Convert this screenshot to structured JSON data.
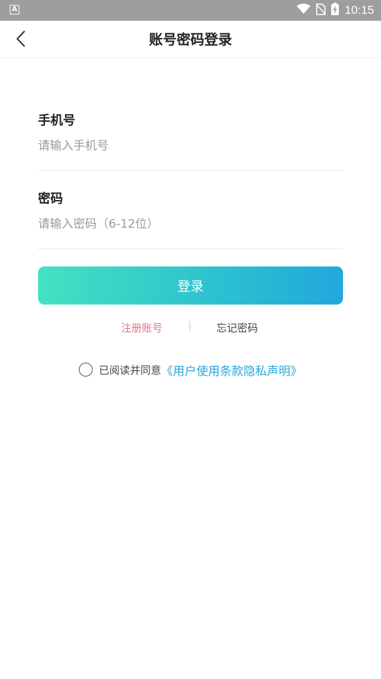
{
  "status_bar": {
    "app_icon_letter": "A",
    "time": "10:15"
  },
  "nav": {
    "title": "账号密码登录"
  },
  "phone": {
    "label": "手机号",
    "placeholder": "请输入手机号",
    "value": ""
  },
  "password": {
    "label": "密码",
    "placeholder": "请输入密码（6-12位）",
    "value": ""
  },
  "login": {
    "label": "登录"
  },
  "links": {
    "register": "注册账号",
    "separator": "|",
    "forgot": "忘记密码"
  },
  "agreement": {
    "prefix": "已阅读并同意",
    "link": "《用户使用条款隐私声明》",
    "checked": false
  },
  "colors": {
    "status_bar": "#9e9e9e",
    "button_gradient_start": "#44e2c0",
    "button_gradient_end": "#22a7dc",
    "register_link": "#ee6f8a",
    "agreement_link": "#2aa5dd"
  }
}
